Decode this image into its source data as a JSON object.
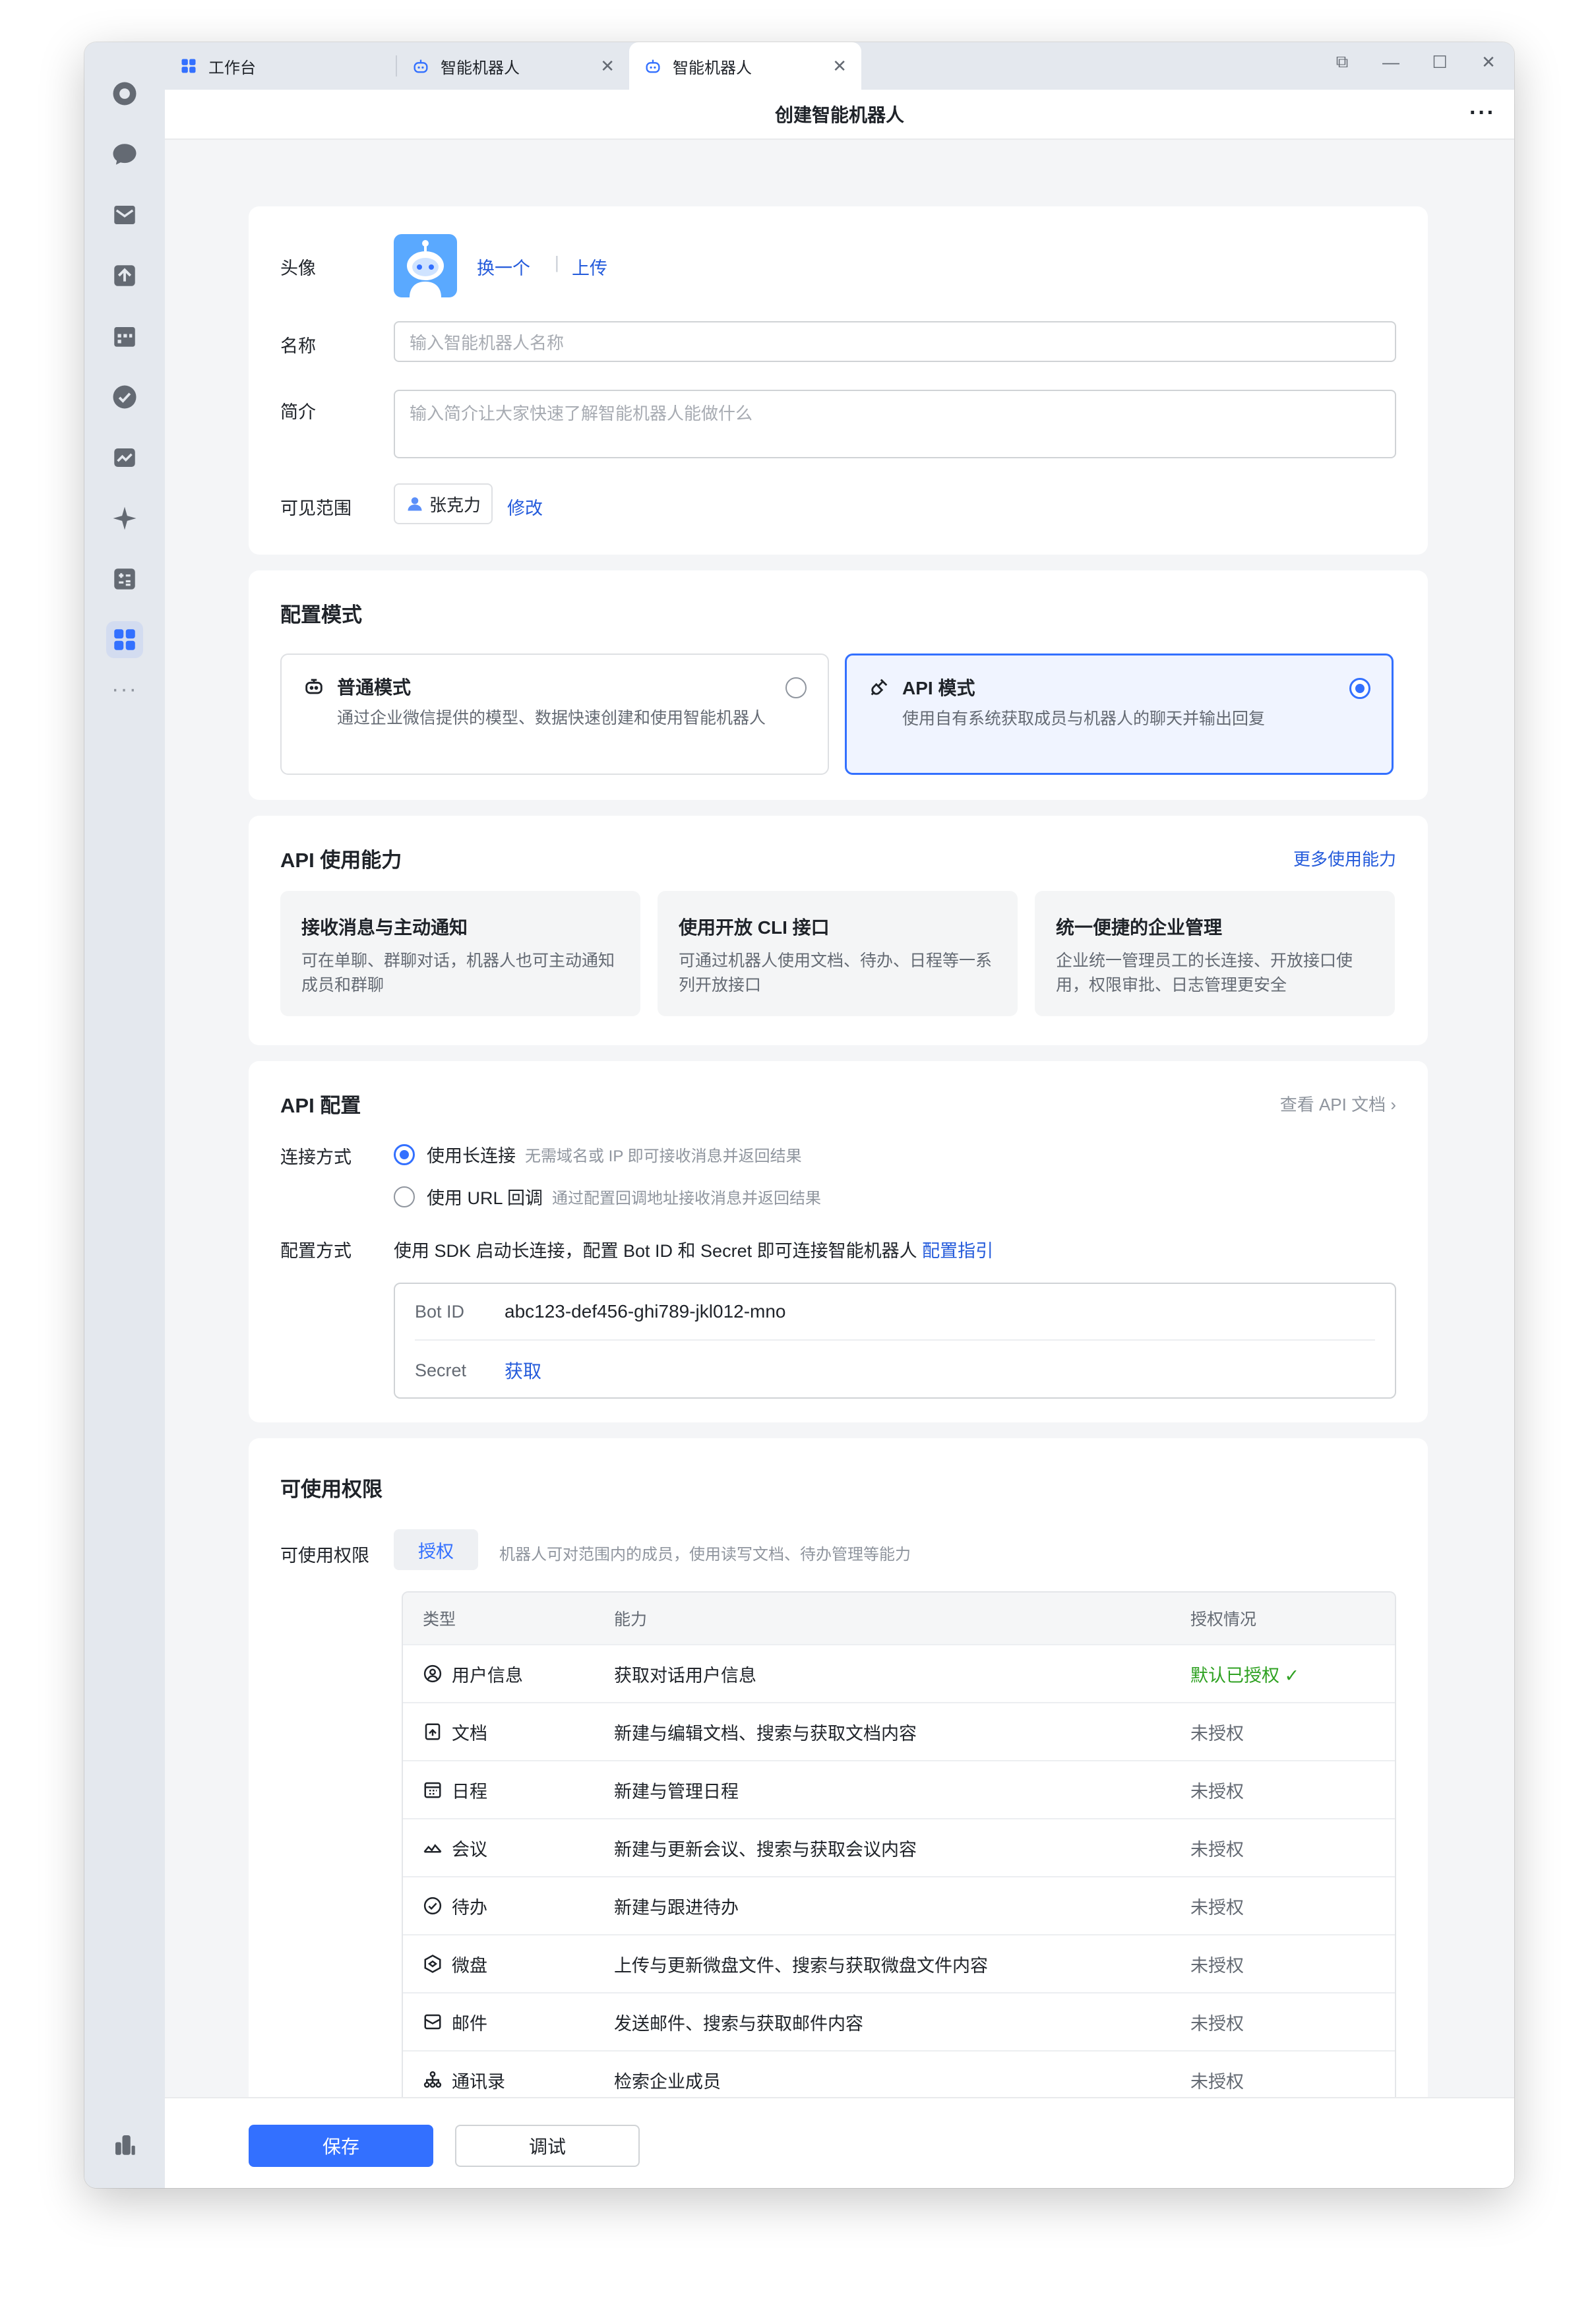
{
  "tabs": [
    {
      "label": "工作台",
      "icon": "grid-icon",
      "closable": false
    },
    {
      "label": "智能机器人",
      "icon": "robot-icon",
      "closable": true
    },
    {
      "label": "智能机器人",
      "icon": "robot-icon",
      "closable": true,
      "active": true
    }
  ],
  "page_title": "创建智能机器人",
  "profile": {
    "avatar_label": "头像",
    "change_link": "换一个",
    "upload_link": "上传",
    "name_label": "名称",
    "name_placeholder": "输入智能机器人名称",
    "intro_label": "简介",
    "intro_placeholder": "输入简介让大家快速了解智能机器人能做什么",
    "scope_label": "可见范围",
    "scope_user": "张克力",
    "scope_edit": "修改"
  },
  "mode": {
    "title": "配置模式",
    "normal": {
      "label": "普通模式",
      "desc": "通过企业微信提供的模型、数据快速创建和使用智能机器人",
      "selected": false
    },
    "api": {
      "label": "API 模式",
      "desc": "使用自有系统获取成员与机器人的聊天并输出回复",
      "selected": true
    }
  },
  "capabilities": {
    "title": "API 使用能力",
    "more_link": "更多使用能力",
    "items": [
      {
        "title": "接收消息与主动通知",
        "desc": "可在单聊、群聊对话，机器人也可主动通知成员和群聊"
      },
      {
        "title": "使用开放 CLI 接口",
        "desc": "可通过机器人使用文档、待办、日程等一系列开放接口"
      },
      {
        "title": "统一便捷的企业管理",
        "desc": "企业统一管理员工的长连接、开放接口使用，权限审批、日志管理更安全"
      }
    ]
  },
  "api_config": {
    "title": "API 配置",
    "docs_link": "查看 API 文档",
    "conn_label": "连接方式",
    "options": [
      {
        "label": "使用长连接",
        "hint": "无需域名或 IP 即可接收消息并返回结果",
        "selected": true
      },
      {
        "label": "使用 URL 回调",
        "hint": "通过配置回调地址接收消息并返回结果",
        "selected": false
      }
    ],
    "method_label": "配置方式",
    "method_text": "使用 SDK 启动长连接，配置 Bot ID 和 Secret 即可连接智能机器人",
    "guide_link": "配置指引",
    "bot_id_key": "Bot ID",
    "bot_id_value": "abc123-def456-ghi789-jkl012-mno",
    "secret_key": "Secret",
    "secret_link": "获取"
  },
  "permissions": {
    "title": "可使用权限",
    "row_label": "可使用权限",
    "authorize_button": "授权",
    "hint": "机器人可对范围内的成员，使用读写文档、待办管理等能力",
    "headers": [
      "类型",
      "能力",
      "授权情况"
    ],
    "rows": [
      {
        "type": "用户信息",
        "icon": "user-circle-icon",
        "ability": "获取对话用户信息",
        "status": "默认已授权",
        "granted": true
      },
      {
        "type": "文档",
        "icon": "document-icon",
        "ability": "新建与编辑文档、搜索与获取文档内容",
        "status": "未授权",
        "granted": false
      },
      {
        "type": "日程",
        "icon": "calendar-icon",
        "ability": "新建与管理日程",
        "status": "未授权",
        "granted": false
      },
      {
        "type": "会议",
        "icon": "meeting-icon",
        "ability": "新建与更新会议、搜索与获取会议内容",
        "status": "未授权",
        "granted": false
      },
      {
        "type": "待办",
        "icon": "todo-check-icon",
        "ability": "新建与跟进待办",
        "status": "未授权",
        "granted": false
      },
      {
        "type": "微盘",
        "icon": "drive-icon",
        "ability": "上传与更新微盘文件、搜索与获取微盘文件内容",
        "status": "未授权",
        "granted": false
      },
      {
        "type": "邮件",
        "icon": "mail-icon",
        "ability": "发送邮件、搜索与获取邮件内容",
        "status": "未授权",
        "granted": false
      },
      {
        "type": "通讯录",
        "icon": "org-chart-icon",
        "ability": "检索企业成员",
        "status": "未授权",
        "granted": false
      }
    ]
  },
  "footer": {
    "save": "保存",
    "debug": "调试"
  },
  "colors": {
    "accent": "#3370ff",
    "granted": "#2ea121",
    "rail_bg": "#e4e8ee"
  }
}
